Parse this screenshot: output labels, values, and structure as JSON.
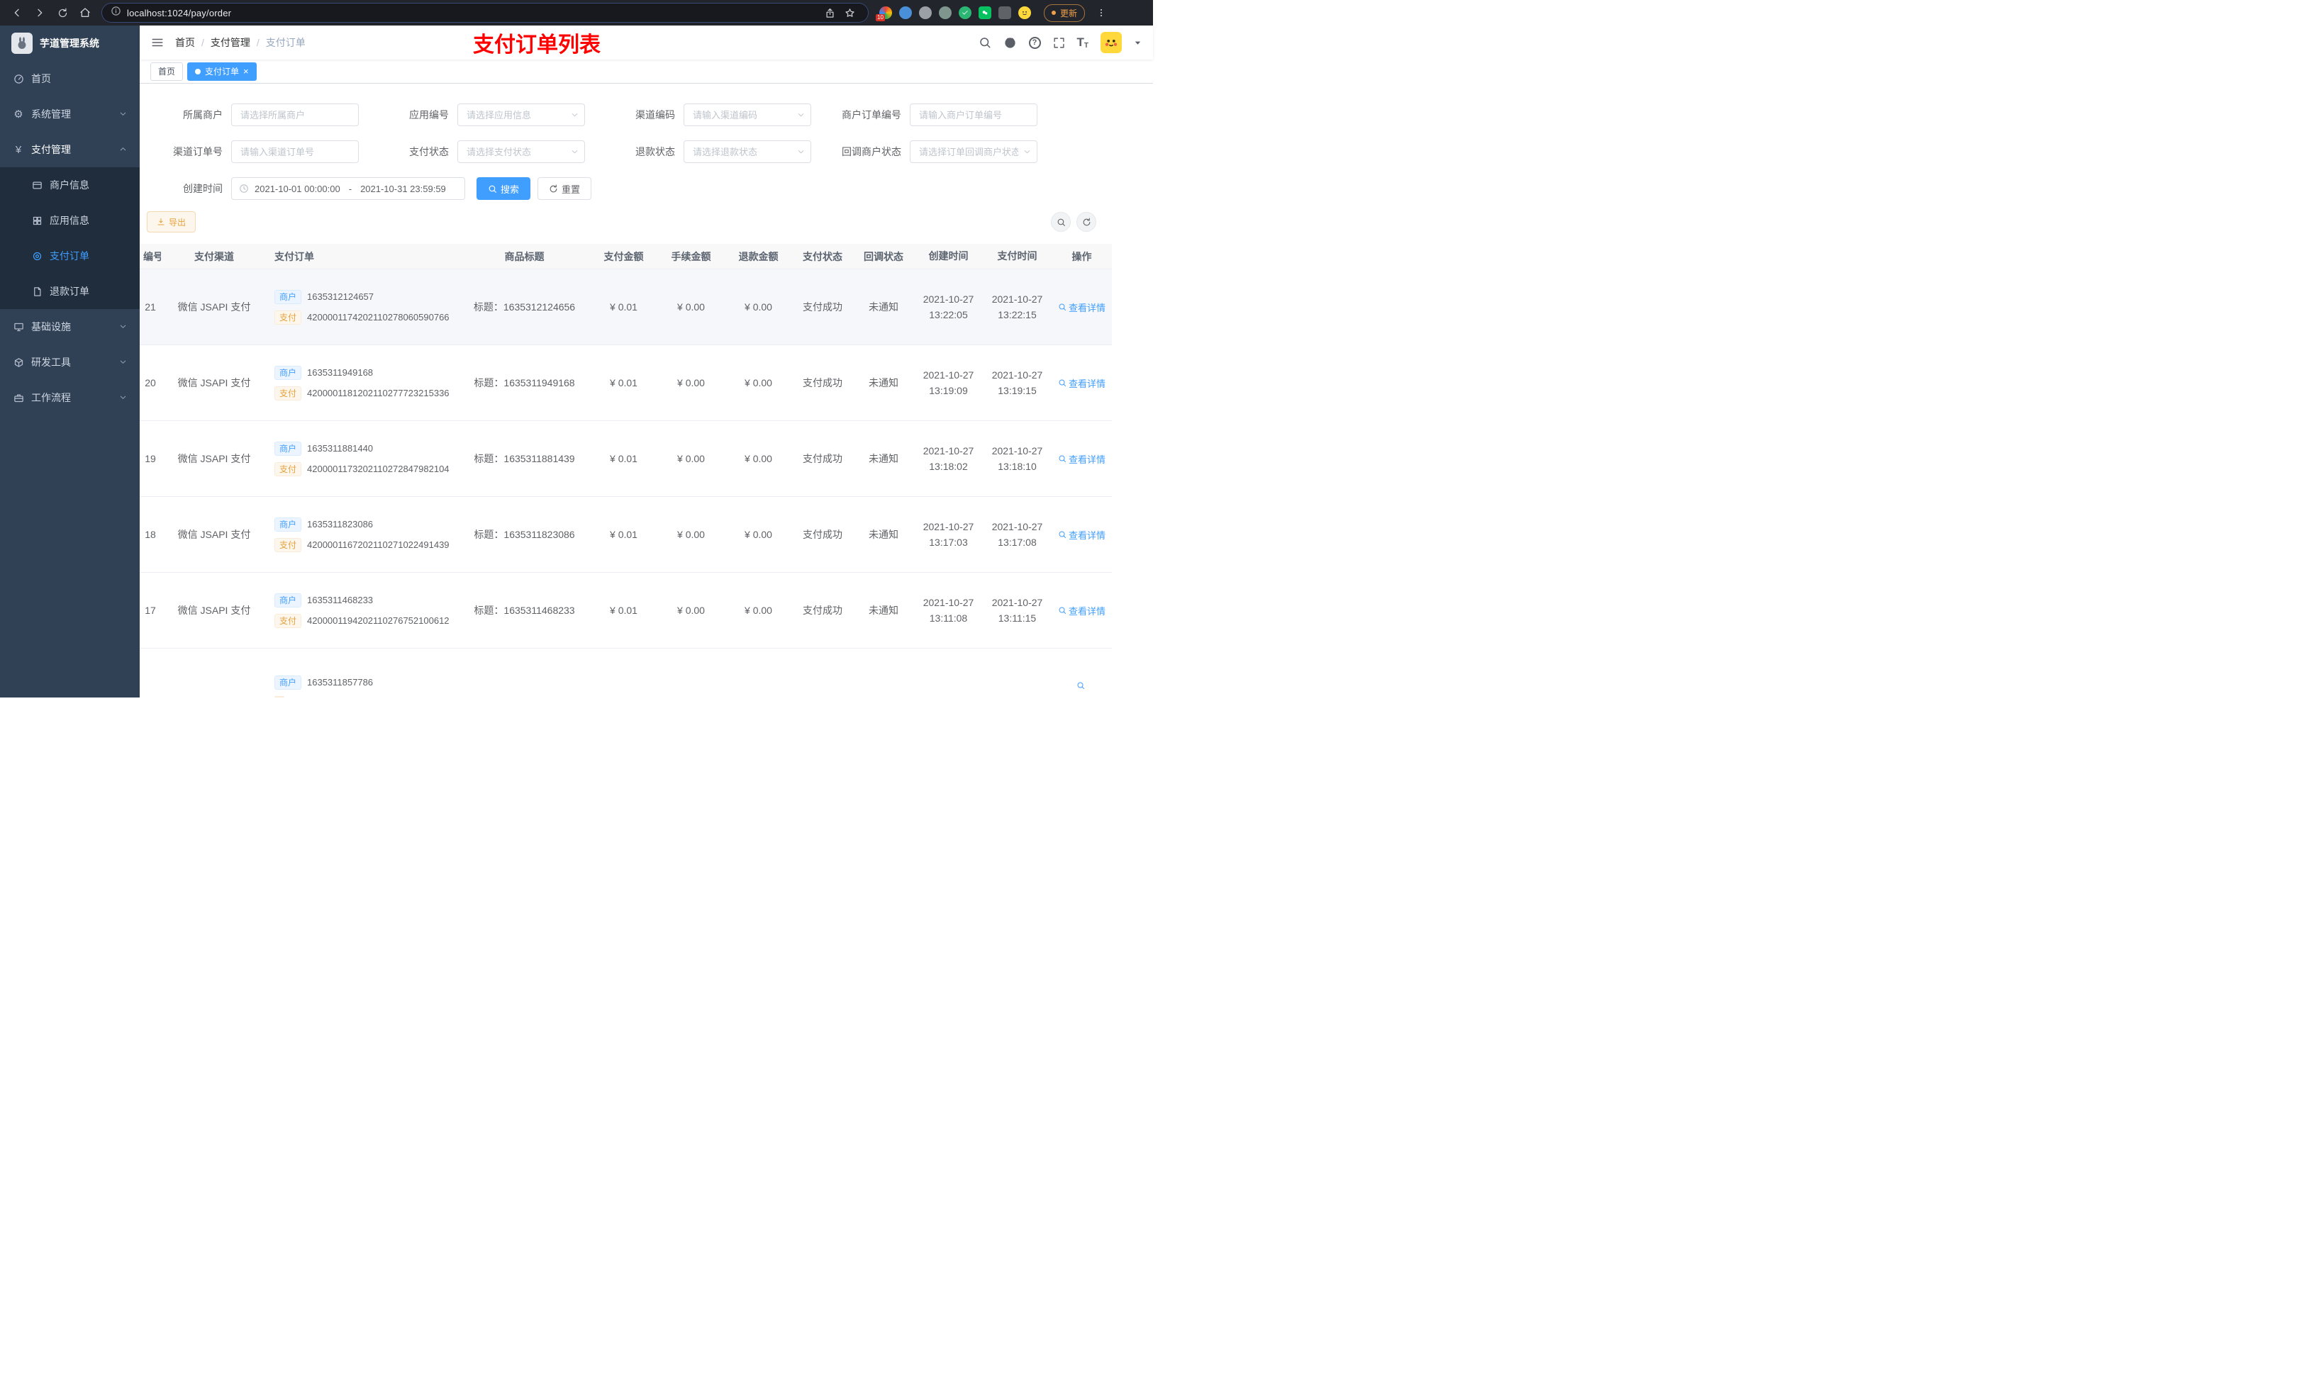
{
  "browser": {
    "url": "localhost:1024/pay/order",
    "update_label": "更新",
    "extension_badge": "10"
  },
  "app": {
    "logo_title": "芋道管理系统"
  },
  "icons": {
    "question_glyph": "?",
    "yen_glyph": "¥",
    "gear_glyph": "⚙",
    "font_glyph": "T"
  },
  "sidebar": {
    "items": [
      {
        "label": "首页"
      },
      {
        "label": "系统管理"
      },
      {
        "label": "支付管理"
      },
      {
        "label": "基础设施"
      },
      {
        "label": "研发工具"
      },
      {
        "label": "工作流程"
      }
    ],
    "payment_children": [
      {
        "label": "商户信息"
      },
      {
        "label": "应用信息"
      },
      {
        "label": "支付订单"
      },
      {
        "label": "退款订单"
      }
    ]
  },
  "header": {
    "breadcrumb": [
      "首页",
      "支付管理",
      "支付订单"
    ],
    "separator": "/",
    "annotation": "支付订单列表"
  },
  "tabs": [
    {
      "label": "首页"
    },
    {
      "label": "支付订单",
      "close": "×"
    }
  ],
  "filters": {
    "fields": [
      {
        "label": "所属商户",
        "placeholder": "请选择所属商户"
      },
      {
        "label": "应用编号",
        "placeholder": "请选择应用信息"
      },
      {
        "label": "渠道编码",
        "placeholder": "请输入渠道编码"
      },
      {
        "label": "商户订单编号",
        "placeholder": "请输入商户订单编号"
      },
      {
        "label": "渠道订单号",
        "placeholder": "请输入渠道订单号"
      },
      {
        "label": "支付状态",
        "placeholder": "请选择支付状态"
      },
      {
        "label": "退款状态",
        "placeholder": "请选择退款状态"
      },
      {
        "label": "回调商户状态",
        "placeholder": "请选择订单回调商户状态"
      }
    ],
    "create_time_label": "创建时间",
    "date_start": "2021-10-01 00:00:00",
    "date_separator": "-",
    "date_end": "2021-10-31 23:59:59",
    "search_label": "搜索",
    "reset_label": "重置"
  },
  "toolbar": {
    "export_label": "导出"
  },
  "table": {
    "columns": [
      "编号",
      "支付渠道",
      "支付订单",
      "商品标题",
      "支付金额",
      "手续金额",
      "退款金额",
      "支付状态",
      "回调状态",
      "创建时间",
      "支付时间",
      "操作"
    ],
    "rows": [
      {
        "id": "21",
        "channel": "微信 JSAPI 支付",
        "merchant_tag": "商户",
        "merchant_no": "1635312124657",
        "pay_tag": "支付",
        "pay_no": "4200001174202110278060590766",
        "title": "标题：1635312124656",
        "amount": "¥ 0.01",
        "fee": "¥ 0.00",
        "refund": "¥ 0.00",
        "status": "支付成功",
        "notify": "未通知",
        "create_date": "2021-10-27",
        "create_time": "13:22:05",
        "pay_date": "2021-10-27",
        "pay_time": "13:22:15",
        "action": "查看详情"
      },
      {
        "id": "20",
        "channel": "微信 JSAPI 支付",
        "merchant_tag": "商户",
        "merchant_no": "1635311949168",
        "pay_tag": "支付",
        "pay_no": "4200001181202110277723215336",
        "title": "标题：1635311949168",
        "amount": "¥ 0.01",
        "fee": "¥ 0.00",
        "refund": "¥ 0.00",
        "status": "支付成功",
        "notify": "未通知",
        "create_date": "2021-10-27",
        "create_time": "13:19:09",
        "pay_date": "2021-10-27",
        "pay_time": "13:19:15",
        "action": "查看详情"
      },
      {
        "id": "19",
        "channel": "微信 JSAPI 支付",
        "merchant_tag": "商户",
        "merchant_no": "1635311881440",
        "pay_tag": "支付",
        "pay_no": "4200001173202110272847982104",
        "title": "标题：1635311881439",
        "amount": "¥ 0.01",
        "fee": "¥ 0.00",
        "refund": "¥ 0.00",
        "status": "支付成功",
        "notify": "未通知",
        "create_date": "2021-10-27",
        "create_time": "13:18:02",
        "pay_date": "2021-10-27",
        "pay_time": "13:18:10",
        "action": "查看详情"
      },
      {
        "id": "18",
        "channel": "微信 JSAPI 支付",
        "merchant_tag": "商户",
        "merchant_no": "1635311823086",
        "pay_tag": "支付",
        "pay_no": "4200001167202110271022491439",
        "title": "标题：1635311823086",
        "amount": "¥ 0.01",
        "fee": "¥ 0.00",
        "refund": "¥ 0.00",
        "status": "支付成功",
        "notify": "未通知",
        "create_date": "2021-10-27",
        "create_time": "13:17:03",
        "pay_date": "2021-10-27",
        "pay_time": "13:17:08",
        "action": "查看详情"
      },
      {
        "id": "17",
        "channel": "微信 JSAPI 支付",
        "merchant_tag": "商户",
        "merchant_no": "1635311468233",
        "pay_tag": "支付",
        "pay_no": "4200001194202110276752100612",
        "title": "标题：1635311468233",
        "amount": "¥ 0.01",
        "fee": "¥ 0.00",
        "refund": "¥ 0.00",
        "status": "支付成功",
        "notify": "未通知",
        "create_date": "2021-10-27",
        "create_time": "13:11:08",
        "pay_date": "2021-10-27",
        "pay_time": "13:11:15",
        "action": "查看详情"
      },
      {
        "id": "",
        "channel": "",
        "merchant_tag": "商户",
        "merchant_no": "1635311857786",
        "pay_tag": "",
        "pay_no": "",
        "title": "",
        "amount": "",
        "fee": "",
        "refund": "",
        "status": "",
        "notify": "",
        "create_date": "",
        "create_time": "",
        "pay_date": "",
        "pay_time": "",
        "action": ""
      }
    ]
  }
}
